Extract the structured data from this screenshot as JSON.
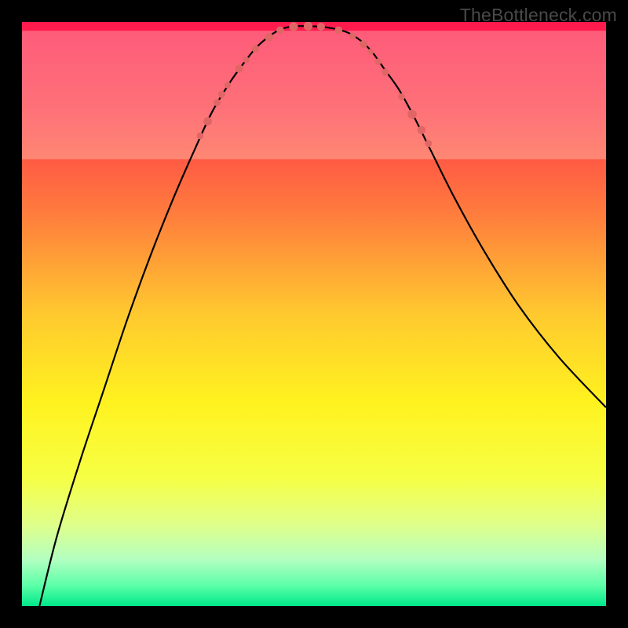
{
  "watermark": "TheBottleneck.com",
  "chart_data": {
    "type": "line",
    "title": "",
    "xlabel": "",
    "ylabel": "",
    "xlim": [
      0,
      100
    ],
    "ylim": [
      0,
      100
    ],
    "gradient_stops": [
      {
        "offset": 0,
        "color": "#ff1a4d"
      },
      {
        "offset": 0.15,
        "color": "#ff3b4a"
      },
      {
        "offset": 0.33,
        "color": "#ff7d3d"
      },
      {
        "offset": 0.5,
        "color": "#ffc92f"
      },
      {
        "offset": 0.65,
        "color": "#fff21f"
      },
      {
        "offset": 0.78,
        "color": "#f6ff44"
      },
      {
        "offset": 0.86,
        "color": "#e0ff8a"
      },
      {
        "offset": 0.92,
        "color": "#b3ffc0"
      },
      {
        "offset": 0.965,
        "color": "#5cffa8"
      },
      {
        "offset": 1.0,
        "color": "#00e889"
      }
    ],
    "pale_band": {
      "y_top": 76.5,
      "y_bottom": 98.5,
      "color": "#fafff0",
      "opacity": 0.28
    },
    "series": [
      {
        "name": "curve",
        "x": [
          3,
          6,
          10,
          14,
          18,
          22,
          26,
          29.5,
          32.5,
          35.5,
          38,
          40,
          42,
          44,
          46,
          48.5,
          52,
          55.5,
          58,
          60,
          62,
          64.5,
          67,
          70,
          74,
          79,
          85,
          92,
          100
        ],
        "y": [
          0,
          12,
          25,
          37,
          49,
          60,
          70,
          78,
          84.5,
          89.5,
          93,
          95.5,
          97.3,
          98.6,
          99.2,
          99.3,
          99.1,
          98.3,
          96.8,
          94.8,
          92,
          88.5,
          84,
          78,
          70,
          61,
          51.5,
          42.5,
          34
        ]
      }
    ],
    "markers": [
      {
        "x": 30.5,
        "y": 80.5,
        "r": 4.3
      },
      {
        "x": 31.8,
        "y": 83.0,
        "r": 5.4
      },
      {
        "x": 33.4,
        "y": 86.2,
        "r": 4.6
      },
      {
        "x": 34.2,
        "y": 87.6,
        "r": 4.6
      },
      {
        "x": 35.2,
        "y": 89.2,
        "r": 4.2
      },
      {
        "x": 37.2,
        "y": 92.0,
        "r": 5.2
      },
      {
        "x": 38.4,
        "y": 93.5,
        "r": 4.0
      },
      {
        "x": 40.0,
        "y": 95.4,
        "r": 4.8
      },
      {
        "x": 42.3,
        "y": 97.4,
        "r": 5.4
      },
      {
        "x": 44.2,
        "y": 98.6,
        "r": 4.8
      },
      {
        "x": 46.5,
        "y": 99.2,
        "r": 5.6
      },
      {
        "x": 49.0,
        "y": 99.3,
        "r": 5.6
      },
      {
        "x": 51.2,
        "y": 99.2,
        "r": 5.0
      },
      {
        "x": 54.2,
        "y": 98.6,
        "r": 4.8
      },
      {
        "x": 56.6,
        "y": 97.6,
        "r": 4.4
      },
      {
        "x": 58.5,
        "y": 96.2,
        "r": 5.0
      },
      {
        "x": 59.7,
        "y": 94.9,
        "r": 4.0
      },
      {
        "x": 61.0,
        "y": 93.2,
        "r": 4.2
      },
      {
        "x": 62.2,
        "y": 91.4,
        "r": 4.6
      },
      {
        "x": 65.0,
        "y": 87.2,
        "r": 4.4
      },
      {
        "x": 66.8,
        "y": 84.2,
        "r": 5.8
      },
      {
        "x": 68.4,
        "y": 81.5,
        "r": 5.2
      },
      {
        "x": 69.6,
        "y": 79.2,
        "r": 4.4
      }
    ],
    "marker_color": "#e06666"
  }
}
